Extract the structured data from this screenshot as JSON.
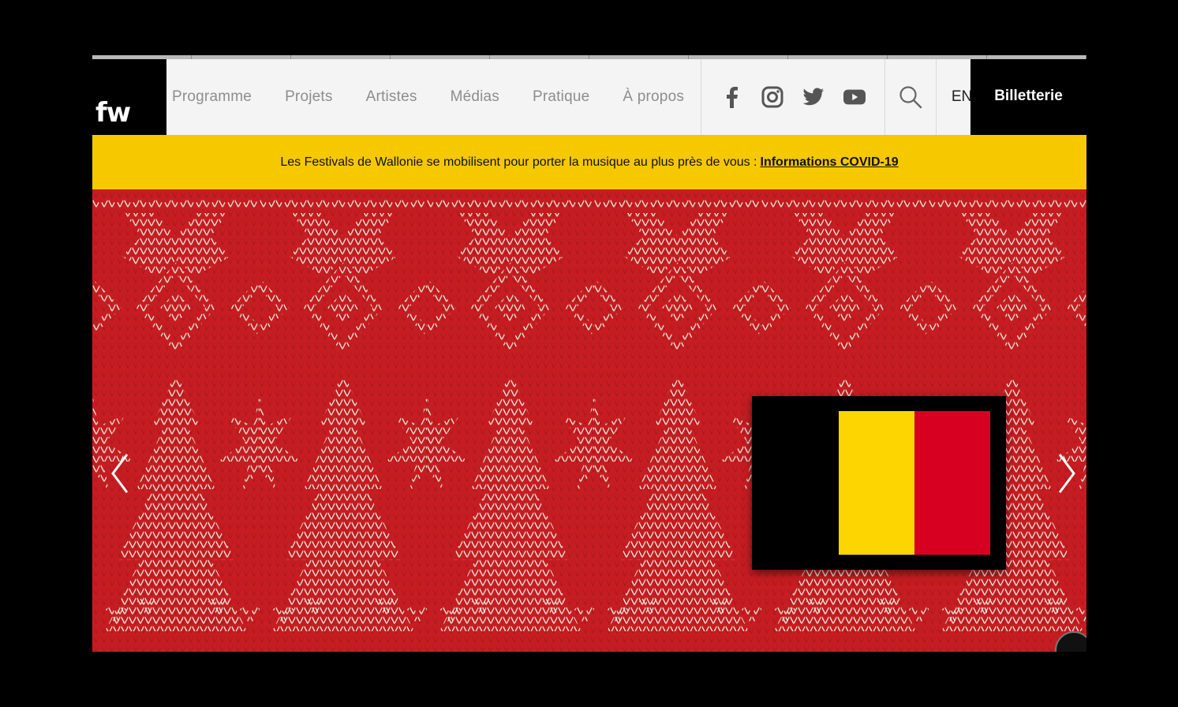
{
  "logo": {
    "text": "fw"
  },
  "nav": {
    "items": [
      "Programme",
      "Projets",
      "Artistes",
      "Médias",
      "Pratique",
      "À propos"
    ]
  },
  "social": {
    "icons": [
      "facebook-icon",
      "instagram-icon",
      "twitter-icon",
      "youtube-icon"
    ]
  },
  "header": {
    "lang_label": "EN",
    "ticket_label": "Billetterie"
  },
  "banner": {
    "text": "Les Festivals de Wallonie se mobilisent pour porter la musique au plus près de vous :",
    "link": "Informations COVID-19"
  },
  "hero": {
    "flag_colors": [
      "#000000",
      "#fdd500",
      "#d70021"
    ]
  },
  "colors": {
    "banner": "#f5c800",
    "hero_red": "#c51d21",
    "knit_white": "#f2ece2"
  }
}
